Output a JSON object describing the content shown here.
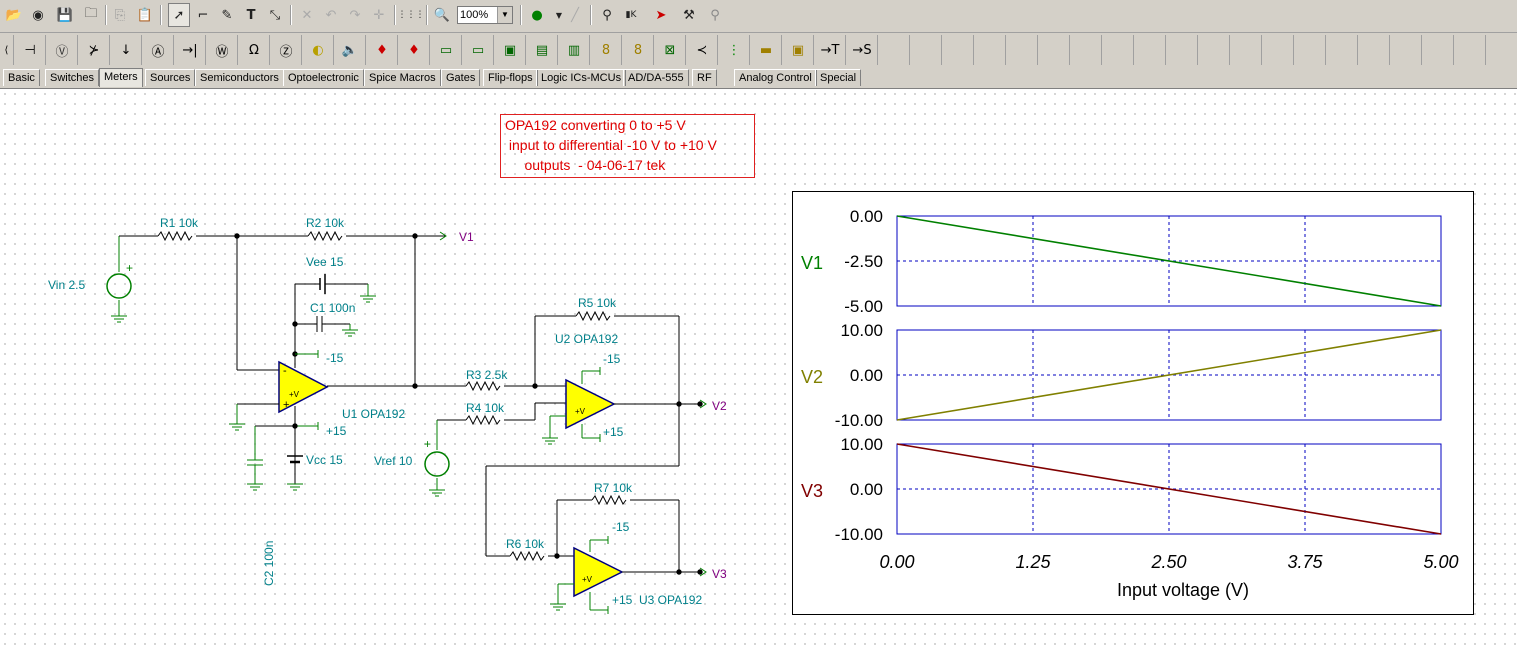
{
  "toolbar": {
    "zoom": "100%",
    "icons": [
      "open-icon",
      "internet-icon",
      "save-icon",
      "open-folder-icon",
      "copy-icon",
      "paste-icon",
      "select-arrow-icon",
      "wire-icon",
      "pencil-icon",
      "text-icon",
      "no-wire-icon",
      "delete-icon",
      "undo-icon",
      "redo-icon",
      "junction-icon",
      "grid-icon",
      "zoom-icon",
      "dc-analysis-icon",
      "probe-pen-icon",
      "probe-voltage-icon",
      "resistor-meter-icon",
      "run-icon",
      "tool-icon",
      "pin-icon"
    ]
  },
  "components": {
    "icons": [
      "ground-icon",
      "voltmeter-icon",
      "switch-icon",
      "arrow-down-icon",
      "ammeter-icon",
      "wire-node-icon",
      "wattmeter-icon",
      "ohmmeter-icon",
      "impedance-meter-icon",
      "lamp-icon",
      "speaker-icon",
      "led-red-icon",
      "led-red2-icon",
      "oscilloscope-icon",
      "signal-analyzer-icon",
      "network-analyzer-icon",
      "frequency-counter-icon",
      "logic-analyzer-icon",
      "seven-segment-icon",
      "seven-segment-2-icon",
      "xy-recorder-icon",
      "voltage-pin-icon",
      "traffic-light-icon",
      "display-bar-icon",
      "lcd-icon"
    ],
    "labels": {
      "to_t": "→T",
      "to_s": "→S"
    }
  },
  "tabs": [
    "Basic",
    "Switches",
    "Meters",
    "Sources",
    "Semiconductors",
    "Optoelectronic",
    "Spice Macros",
    "Gates",
    "Flip-flops",
    "Logic ICs-MCUs",
    "AD/DA-555",
    "RF",
    "Analog Control",
    "Special"
  ],
  "active_tab": "Meters",
  "title_box": "OPA192 converting 0 to +5 V\n input to differential -10 V to +10 V\n     outputs  - 04-06-17 tek",
  "schematic": {
    "r1": "R1 10k",
    "r2": "R2 10k",
    "r3": "R3 2.5k",
    "r4": "R4 10k",
    "r5": "R5 10k",
    "r6": "R6 10k",
    "r7": "R7 10k",
    "vee": "Vee 15",
    "vcc": "Vcc 15",
    "c1": "C1 100n",
    "c2": "C2 100n",
    "vin": "Vin 2.5",
    "vref": "Vref 10",
    "u1": "U1 OPA192",
    "u2": "U2 OPA192",
    "u3": "U3 OPA192",
    "neg15": "-15",
    "pos15": "+15",
    "opamp_supply": "+V",
    "plus": "+",
    "minus": "-",
    "v1": "V1",
    "v2": "V2",
    "v3": "V3"
  },
  "colors": {
    "v1": "#008000",
    "v2": "#808000",
    "v3": "#800000",
    "grid": "#0000c0",
    "title": "#e00000",
    "schematic_text": "#00808a",
    "node_text": "#800080",
    "ground": "#008000",
    "opamp_fill": "#ffff00"
  },
  "chart_data": {
    "type": "line",
    "xlabel": "Input voltage (V)",
    "x_ticks": [
      "0.00",
      "1.25",
      "2.50",
      "3.75",
      "5.00"
    ],
    "xlim": [
      0,
      5
    ],
    "grid": true,
    "panels": [
      {
        "name": "V1",
        "ylim": [
          -5,
          0
        ],
        "y_ticks": [
          "0.00",
          "-2.50",
          "-5.00"
        ],
        "x": [
          0,
          5
        ],
        "y": [
          0,
          -5
        ],
        "color": "#008000"
      },
      {
        "name": "V2",
        "ylim": [
          -10,
          10
        ],
        "y_ticks": [
          "10.00",
          "0.00",
          "-10.00"
        ],
        "x": [
          0,
          5
        ],
        "y": [
          -10,
          10
        ],
        "color": "#808000"
      },
      {
        "name": "V3",
        "ylim": [
          -10,
          10
        ],
        "y_ticks": [
          "10.00",
          "0.00",
          "-10.00"
        ],
        "x": [
          0,
          5
        ],
        "y": [
          10,
          -10
        ],
        "color": "#800000"
      }
    ]
  }
}
